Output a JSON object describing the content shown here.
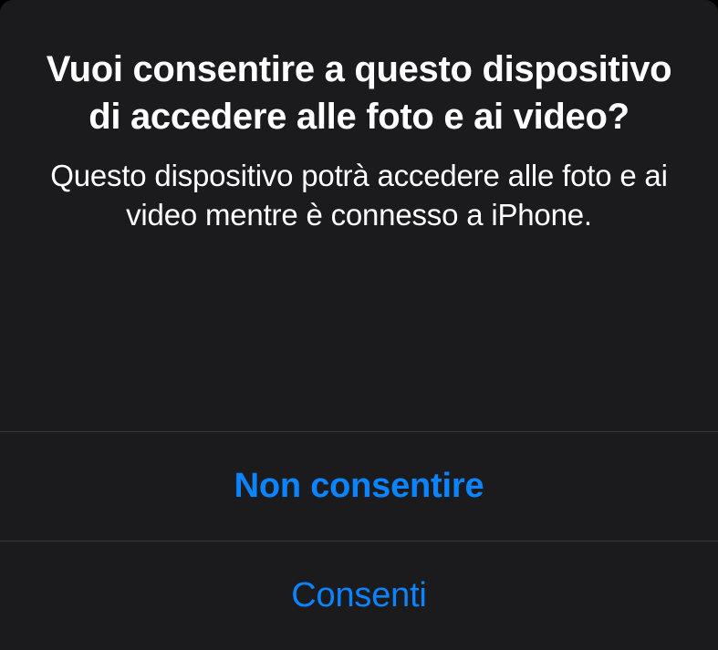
{
  "alert": {
    "title": "Vuoi consentire a questo dispositivo di accedere alle foto e ai video?",
    "message": "Questo dispositivo potrà accedere alle foto e ai video mentre è connesso a iPhone.",
    "deny_button": "Non consentire",
    "allow_button": "Consenti"
  }
}
